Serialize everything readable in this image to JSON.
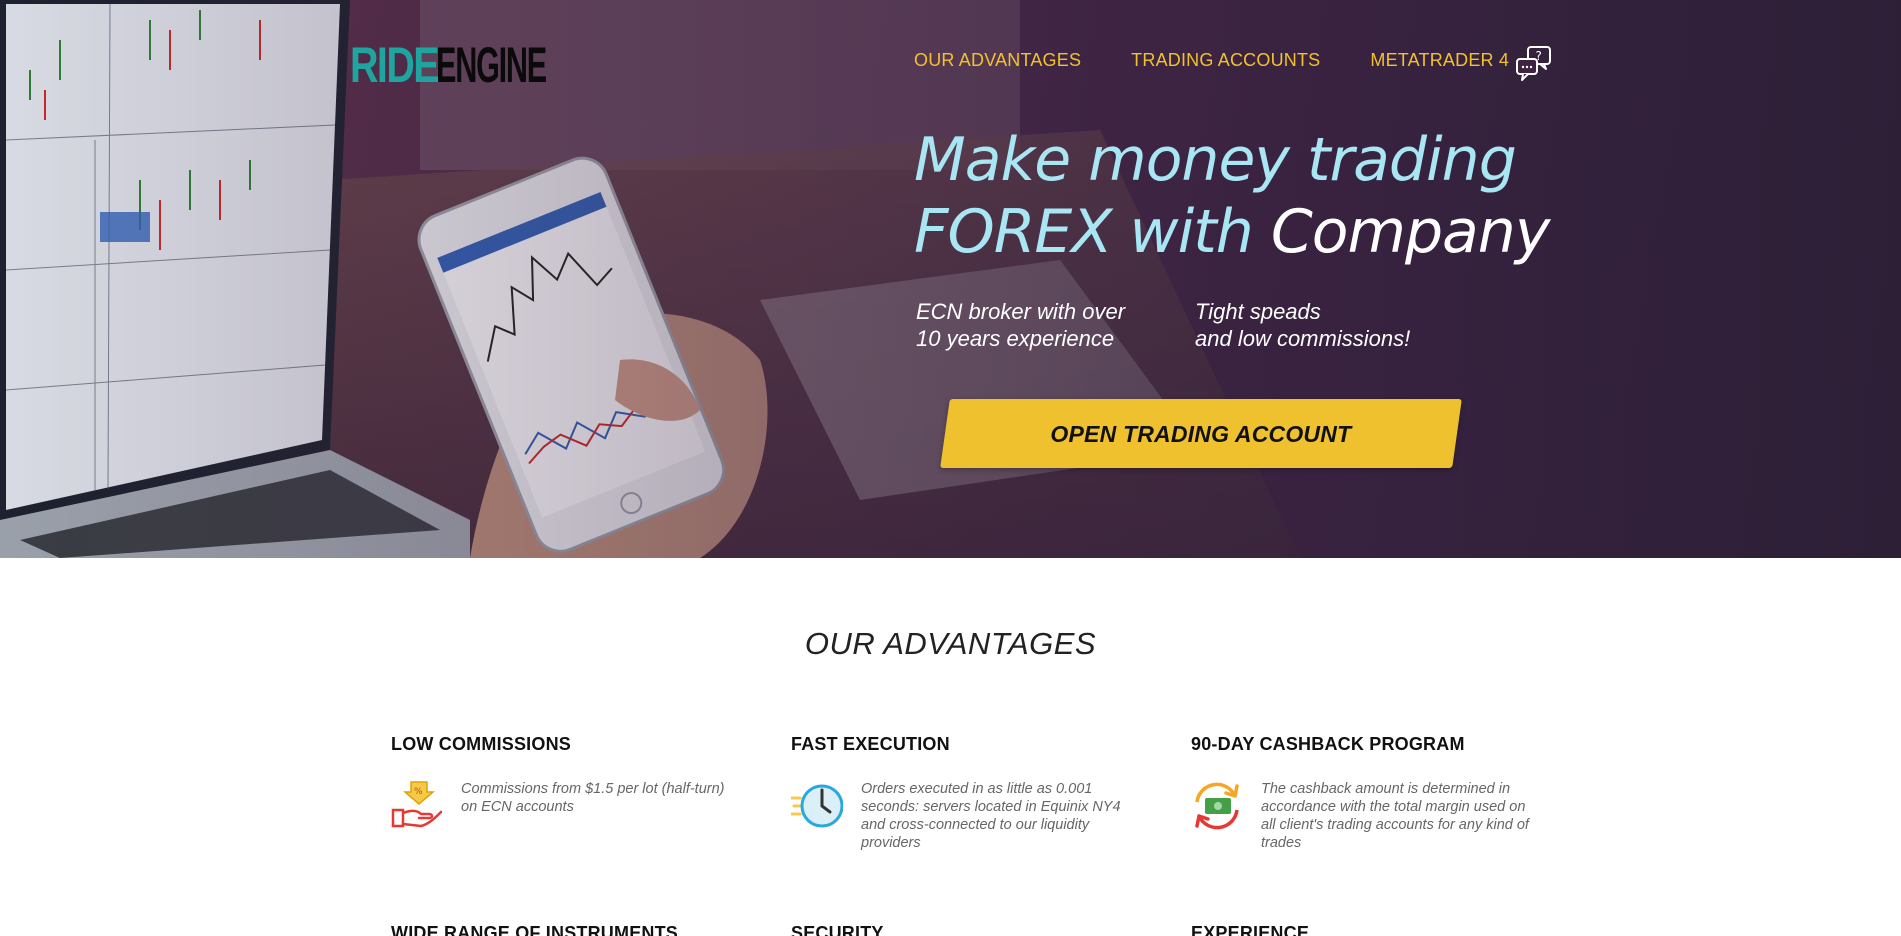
{
  "brand": {
    "logo_text_left": "RIDE",
    "logo_text_right": "ENGINE"
  },
  "nav": {
    "items": [
      "OUR ADVANTAGES",
      "TRADING ACCOUNTS",
      "METATRADER 4"
    ],
    "chat_icon": "chat-question-icon"
  },
  "hero": {
    "headline_line1": "Make money trading",
    "headline_line2_a": "FOREX with ",
    "headline_line2_b": "Company",
    "sub_left": "ECN broker with over\n10 years experience",
    "sub_right": "Tight speads\nand low commissions!",
    "cta_label": "OPEN TRADING ACCOUNT"
  },
  "advantages": {
    "title": "OUR ADVANTAGES",
    "items": [
      {
        "title": "LOW COMMISSIONS",
        "text": "Commissions from $1.5 per lot (half-turn) on ECN accounts",
        "icon": "hand-percent-icon"
      },
      {
        "title": "FAST EXECUTION",
        "text": "Orders executed in as little as 0.001 seconds: servers located in Equinix NY4 and cross-connected to our liquidity providers",
        "icon": "clock-icon"
      },
      {
        "title": "90-DAY CASHBACK PROGRAM",
        "text": "The cashback amount is determined in accordance with the total margin used on all client's trading accounts for any kind of trades",
        "icon": "cashback-icon"
      },
      {
        "title": "WIDE RANGE OF INSTRUMENTS",
        "text": "",
        "icon": ""
      },
      {
        "title": "SECURITY",
        "text": "",
        "icon": ""
      },
      {
        "title": "EXPERIENCE",
        "text": "",
        "icon": ""
      }
    ]
  },
  "colors": {
    "accent": "#f0c12e",
    "nav": "#f2c12e",
    "headline": "#a8e6f4",
    "brand_teal": "#1fa5a0"
  }
}
